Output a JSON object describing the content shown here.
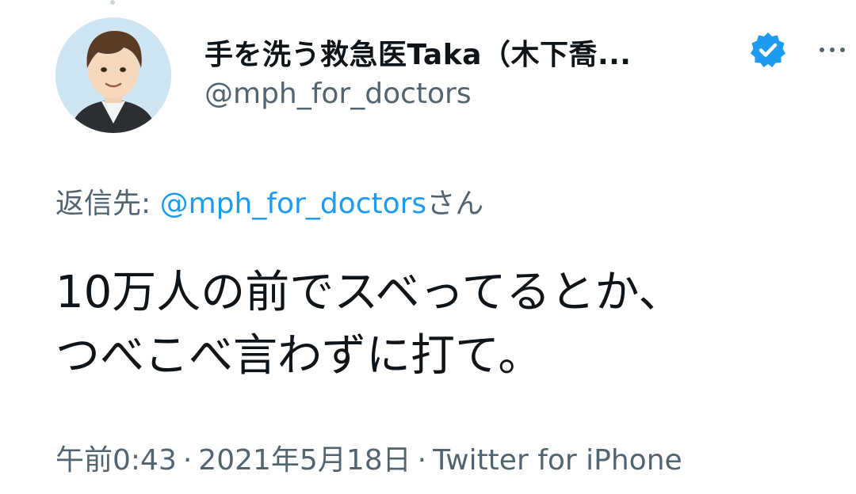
{
  "tweet": {
    "display_name": "手を洗う救急医Taka（木下喬...",
    "handle": "@mph_for_doctors",
    "reply_prefix": "返信先: ",
    "reply_to": "@mph_for_doctors",
    "reply_suffix": "さん",
    "text_lines": [
      "10万人の前でスベってるとか、",
      "つべこべ言わずに打て。"
    ],
    "time": "午前0:43",
    "date": "2021年5月18日",
    "source": "Twitter for iPhone",
    "separator": "·"
  },
  "icons": {
    "verified": "verified-badge-icon",
    "more": "more-options-icon",
    "avatar": "avatar-illustration"
  },
  "colors": {
    "text": "#0f1419",
    "secondary": "#536471",
    "link": "#1d9bf0",
    "verified": "#1d9bf0",
    "avatar_bg": "#cfe6f2"
  }
}
